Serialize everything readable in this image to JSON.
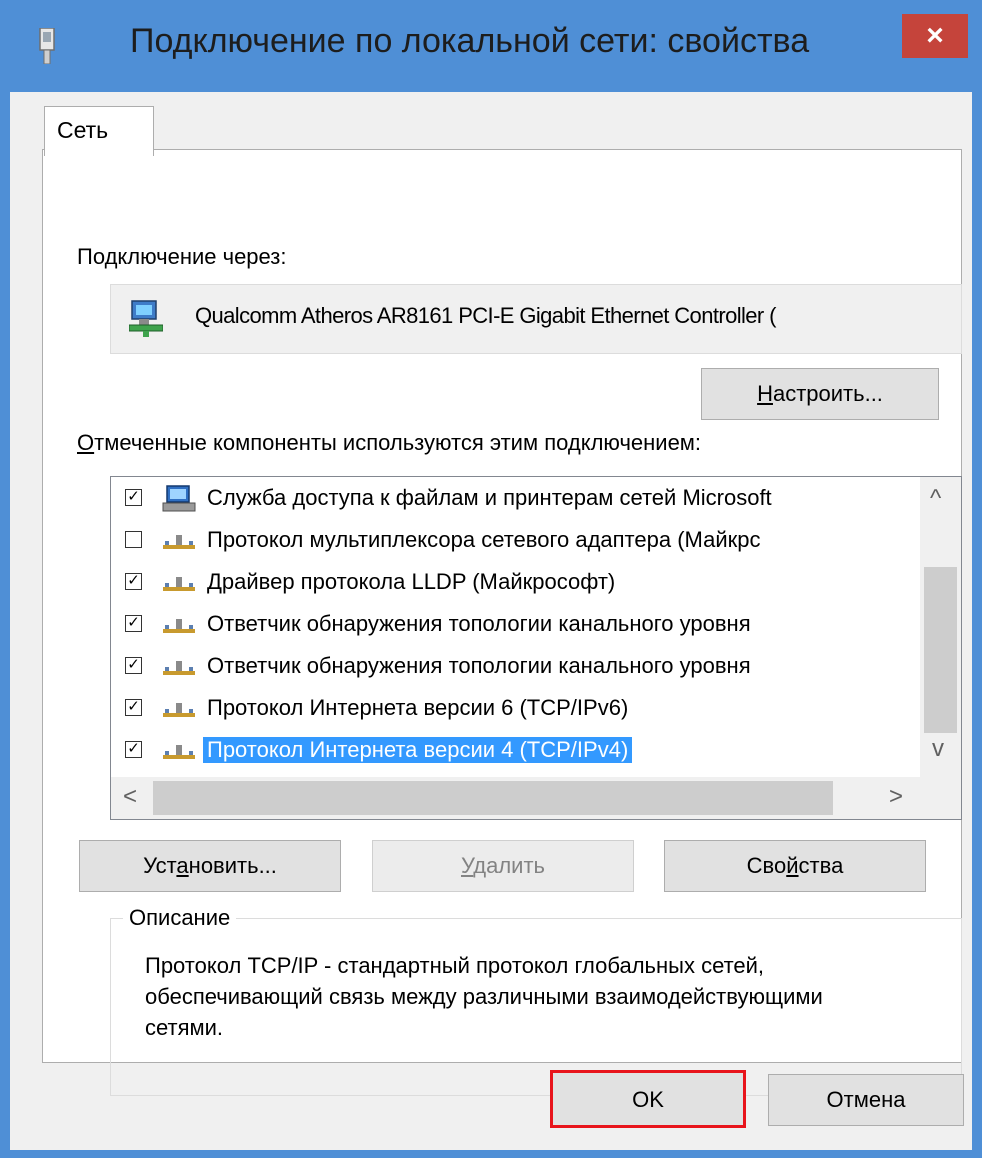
{
  "window": {
    "title": "Подключение по локальной сети: свойства",
    "close_glyph": "×"
  },
  "tab": {
    "label": "Сеть"
  },
  "connect_via": {
    "label": "Подключение через:",
    "adapter_name": "Qualcomm Atheros AR8161 PCI-E Gigabit Ethernet Controller (",
    "adapter_icon": "network-adapter-icon"
  },
  "configure_button": {
    "label_underlined": "Н",
    "label_rest": "астроить..."
  },
  "components": {
    "label_underlined": "О",
    "label_rest": "тмеченные компоненты используются этим подключением:",
    "items": [
      {
        "label": "Служба доступа к файлам и принтерам сетей Microsoft",
        "checked": true,
        "icon": "file-printer-sharing-icon",
        "selected": false
      },
      {
        "label": "Протокол мультиплексора сетевого адаптера (Майкрс",
        "checked": false,
        "icon": "protocol-icon",
        "selected": false
      },
      {
        "label": "Драйвер протокола LLDP (Майкрософт)",
        "checked": true,
        "icon": "protocol-icon",
        "selected": false
      },
      {
        "label": "Ответчик обнаружения топологии канального уровня",
        "checked": true,
        "icon": "protocol-icon",
        "selected": false
      },
      {
        "label": "Ответчик обнаружения топологии канального уровня",
        "checked": true,
        "icon": "protocol-icon",
        "selected": false
      },
      {
        "label": "Протокол Интернета версии 6 (TCP/IPv6)",
        "checked": true,
        "icon": "protocol-icon",
        "selected": false
      },
      {
        "label": "Протокол Интернета версии 4 (TCP/IPv4)",
        "checked": true,
        "icon": "protocol-icon",
        "selected": true
      }
    ],
    "scroll_up": "^",
    "scroll_down": "v",
    "scroll_left": "<",
    "scroll_right": ">"
  },
  "buttons": {
    "install": {
      "pre": "Уст",
      "u": "а",
      "post": "новить..."
    },
    "remove": {
      "pre": "",
      "u": "У",
      "post": "далить"
    },
    "properties": {
      "pre": "Сво",
      "u": "й",
      "post": "ства"
    }
  },
  "description": {
    "legend": "Описание",
    "text": "Протокол TCP/IP - стандартный протокол глобальных сетей, обеспечивающий связь между различными взаимодействующими сетями."
  },
  "footer": {
    "ok": "OK",
    "cancel": "Отмена"
  },
  "colors": {
    "titlebar": "#4f8fd6",
    "close": "#c5443b",
    "selection": "#3399ff",
    "highlight_box": "#e8141b"
  }
}
